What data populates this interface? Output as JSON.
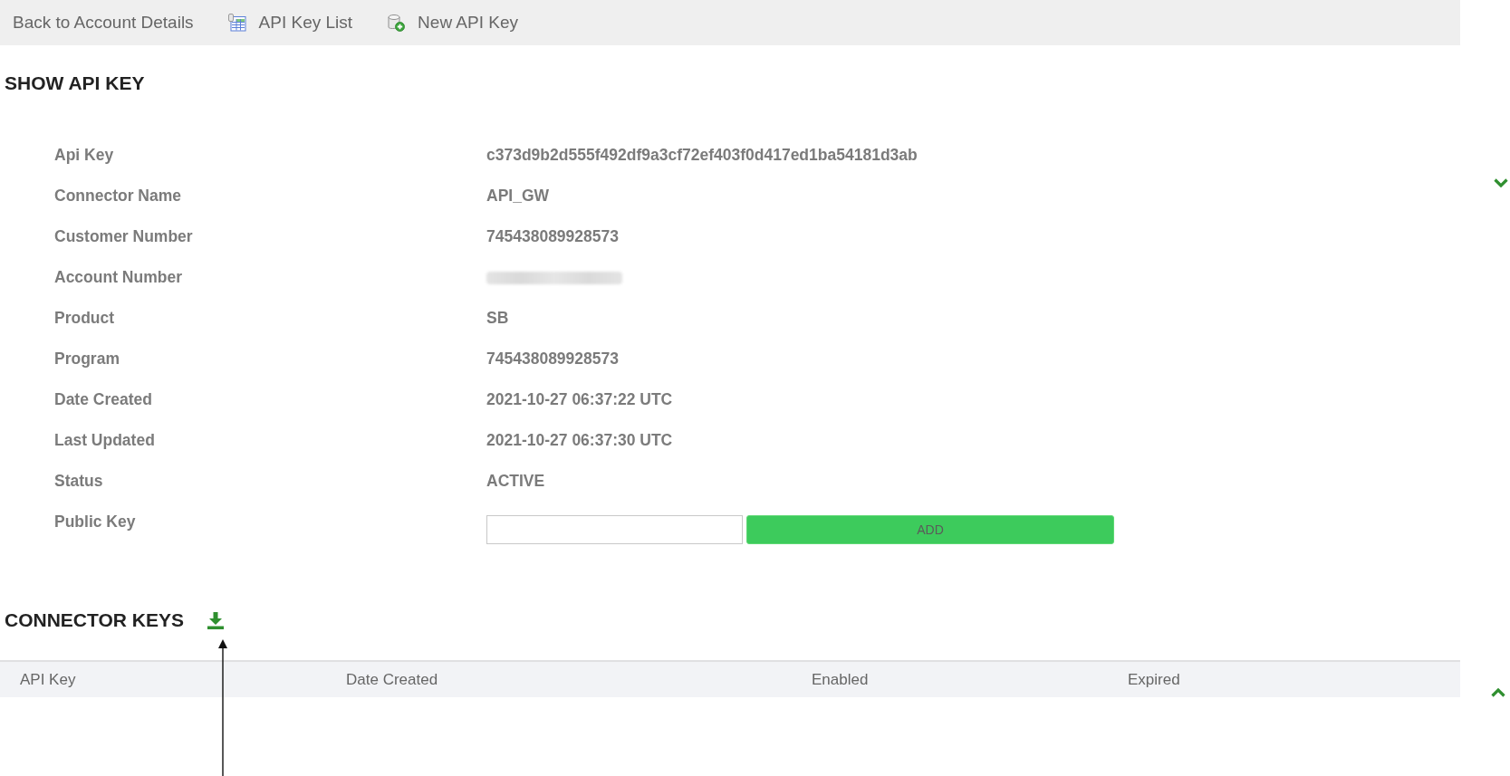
{
  "nav": [
    {
      "kind": "plain",
      "label": "Back to Account Details"
    },
    {
      "kind": "list",
      "label": "API Key List"
    },
    {
      "kind": "add",
      "label": "New API Key"
    }
  ],
  "show_api_key": {
    "title": "SHOW API KEY",
    "fields": [
      {
        "kind": "text",
        "label": "Api Key",
        "value": "c373d9b2d555f492df9a3cf72ef403f0d417ed1ba54181d3ab"
      },
      {
        "kind": "text",
        "label": "Connector Name",
        "value": "API_GW"
      },
      {
        "kind": "text",
        "label": "Customer Number",
        "value": "745438089928573"
      },
      {
        "kind": "redacted",
        "label": "Account Number"
      },
      {
        "kind": "text",
        "label": "Product",
        "value": "SB"
      },
      {
        "kind": "text",
        "label": "Program",
        "value": "745438089928573"
      },
      {
        "kind": "text",
        "label": "Date Created",
        "value": "2021-10-27 06:37:22 UTC"
      },
      {
        "kind": "text",
        "label": "Last Updated",
        "value": "2021-10-27 06:37:30 UTC"
      },
      {
        "kind": "text",
        "label": "Status",
        "value": "ACTIVE"
      },
      {
        "kind": "input",
        "label": "Public Key",
        "button": "ADD"
      }
    ]
  },
  "connector_keys": {
    "title": "CONNECTOR KEYS",
    "columns": [
      "API Key",
      "Date Created",
      "Enabled",
      "Expired"
    ]
  }
}
